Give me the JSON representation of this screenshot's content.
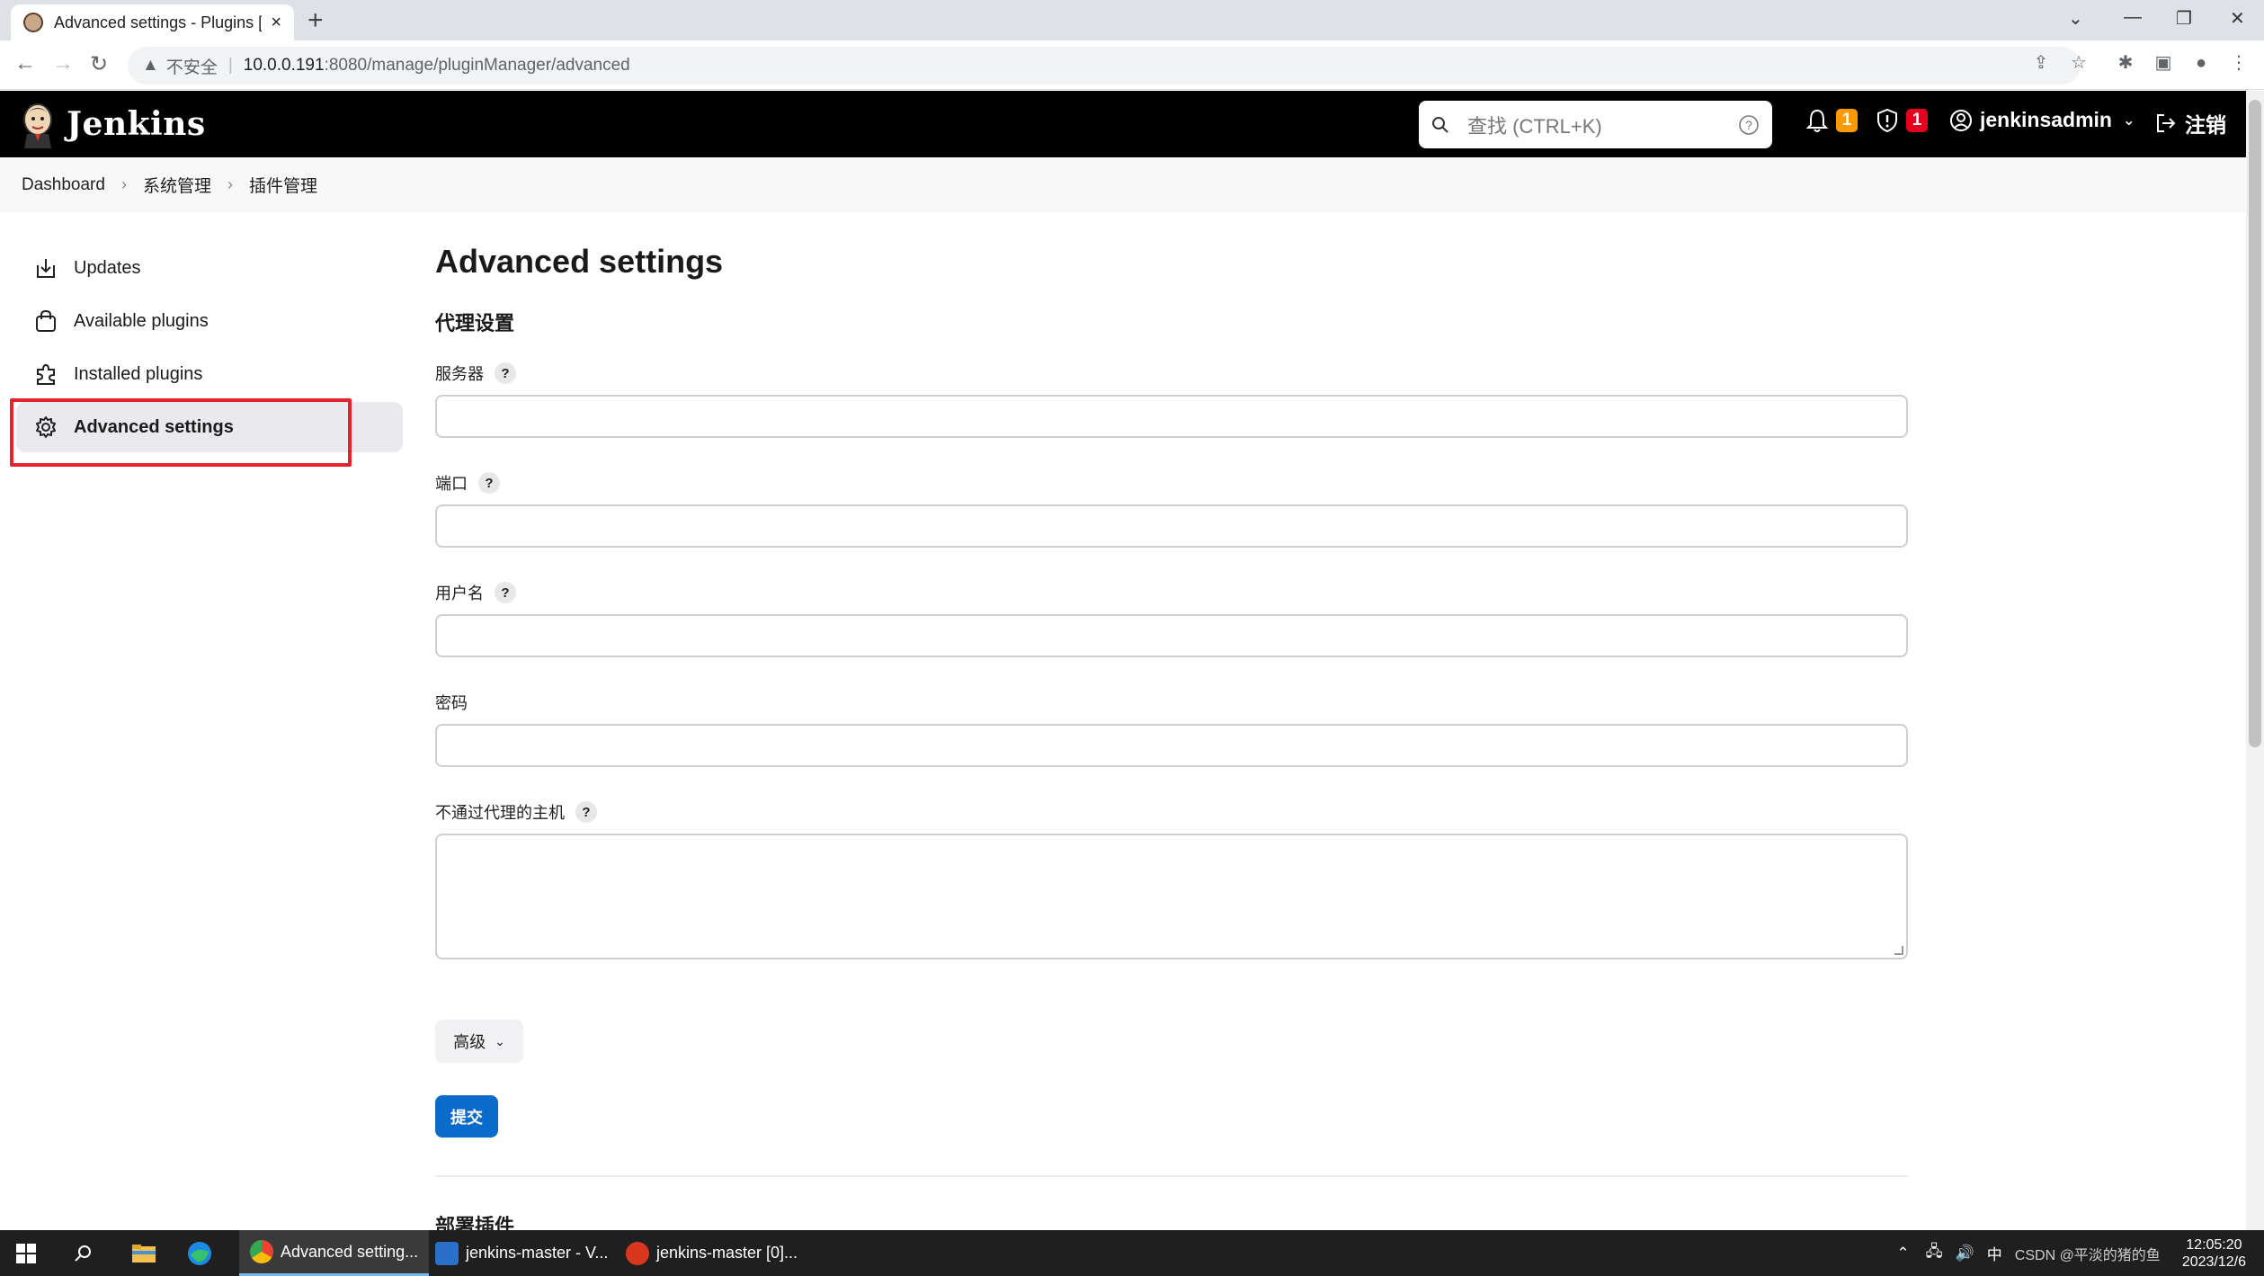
{
  "browser": {
    "tab_title": "Advanced settings - Plugins [J",
    "tab_close": "×",
    "new_tab": "+",
    "insecure_label": "不安全",
    "url_host": "10.0.0.191",
    "url_path": ":8080/manage/pluginManager/advanced"
  },
  "header": {
    "logo_text": "Jenkins",
    "search_placeholder": "查找 (CTRL+K)",
    "notifications_count": "1",
    "security_count": "1",
    "username": "jenkinsadmin",
    "logout_label": "注销"
  },
  "breadcrumb": {
    "items": [
      "Dashboard",
      "系统管理",
      "插件管理"
    ]
  },
  "sidebar": {
    "items": [
      {
        "label": "Updates",
        "icon": "download-icon"
      },
      {
        "label": "Available plugins",
        "icon": "shopping-bag-icon"
      },
      {
        "label": "Installed plugins",
        "icon": "puzzle-icon"
      },
      {
        "label": "Advanced settings",
        "icon": "gear-icon",
        "active": true
      }
    ]
  },
  "main": {
    "title": "Advanced settings",
    "section_title": "代理设置",
    "fields": {
      "server": {
        "label": "服务器",
        "value": ""
      },
      "port": {
        "label": "端口",
        "value": ""
      },
      "username": {
        "label": "用户名",
        "value": ""
      },
      "password": {
        "label": "密码",
        "value": ""
      },
      "no_proxy_hosts": {
        "label": "不通过代理的主机",
        "value": ""
      }
    },
    "advanced_button": "高级",
    "submit_button": "提交",
    "next_section_title": "部署插件"
  },
  "taskbar": {
    "apps": [
      {
        "label": "Advanced setting..."
      },
      {
        "label": "jenkins-master - V..."
      },
      {
        "label": "jenkins-master [0]..."
      }
    ],
    "ime": "中",
    "time": "12:05:20",
    "date": "2023/12/6",
    "watermark": "CSDN @平淡的猪的鱼"
  },
  "colors": {
    "header_bg": "#000000",
    "primary_button": "#0b6bcb",
    "badge_orange": "#fe9a00",
    "badge_red": "#e6001f",
    "highlight_box": "#e6232d"
  }
}
